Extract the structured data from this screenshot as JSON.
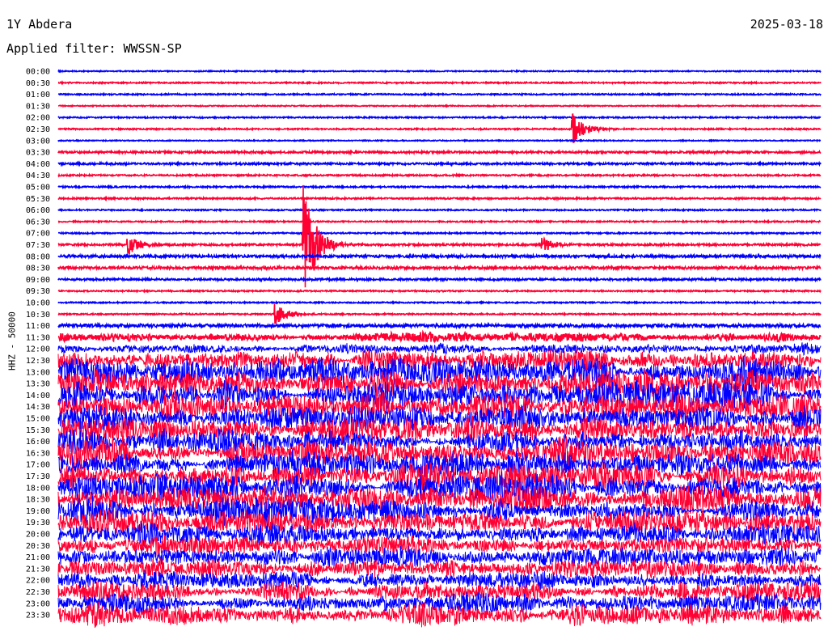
{
  "header": {
    "station": "1Y Abdera",
    "date": "2025-03-18",
    "filter": "Applied filter: WWSSN-SP"
  },
  "chart_data": {
    "type": "line",
    "title": "1Y Abdera 2025-03-18",
    "ylabel": "HHZ - 50000",
    "xlabel": "",
    "row_minutes": 30,
    "colors": [
      "#0000ff",
      "#ff0033"
    ],
    "rows": [
      "00:00",
      "00:30",
      "01:00",
      "01:30",
      "02:00",
      "02:30",
      "03:00",
      "03:30",
      "04:00",
      "04:30",
      "05:00",
      "05:30",
      "06:00",
      "06:30",
      "07:00",
      "07:30",
      "08:00",
      "08:30",
      "09:00",
      "09:30",
      "10:00",
      "10:30",
      "11:00",
      "11:30",
      "12:00",
      "12:30",
      "13:00",
      "13:30",
      "14:00",
      "14:30",
      "15:00",
      "15:30",
      "16:00",
      "16:30",
      "17:00",
      "17:30",
      "18:00",
      "18:30",
      "19:00",
      "19:30",
      "20:00",
      "20:30",
      "21:00",
      "21:30",
      "22:00",
      "22:30",
      "23:00",
      "23:30"
    ],
    "noise_level": [
      0.08,
      0.1,
      0.1,
      0.08,
      0.1,
      0.1,
      0.08,
      0.15,
      0.15,
      0.12,
      0.12,
      0.12,
      0.1,
      0.1,
      0.1,
      0.15,
      0.2,
      0.2,
      0.15,
      0.1,
      0.1,
      0.1,
      0.25,
      0.45,
      0.6,
      1.3,
      1.4,
      1.4,
      1.5,
      1.4,
      1.3,
      1.3,
      1.3,
      1.4,
      1.5,
      1.5,
      1.4,
      1.4,
      1.3,
      1.3,
      1.2,
      1.1,
      1.0,
      1.0,
      1.0,
      1.0,
      1.0,
      1.0
    ],
    "events": [
      {
        "row": "02:30",
        "minute": 20.2,
        "amplitude": 3.0
      },
      {
        "row": "07:30",
        "minute": 2.7,
        "amplitude": 2.2
      },
      {
        "row": "07:30",
        "minute": 9.6,
        "amplitude": 12.0
      },
      {
        "row": "07:30",
        "minute": 19.0,
        "amplitude": 1.5
      },
      {
        "row": "10:30",
        "minute": 8.5,
        "amplitude": 2.0
      }
    ]
  }
}
